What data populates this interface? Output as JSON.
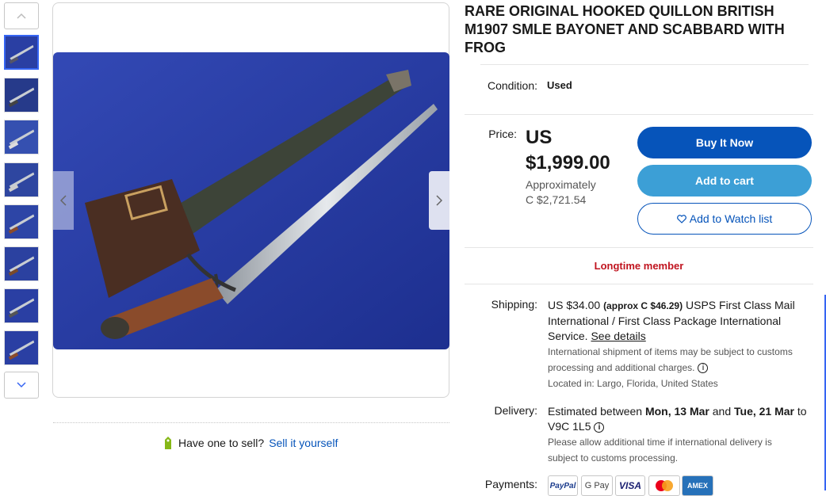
{
  "listing": {
    "title": "RARE ORIGINAL HOOKED QUILLON BRITISH M1907 SMLE BAYONET AND SCABBARD WITH FROG",
    "condition_label": "Condition:",
    "condition_value": "Used",
    "price_label": "Price:",
    "price_currency": "US",
    "price_amount": "$1,999.00",
    "approx_label": "Approximately",
    "approx_value": "C $2,721.54"
  },
  "actions": {
    "buy_now": "Buy It Now",
    "add_to_cart": "Add to cart",
    "watch": "Add to Watch list"
  },
  "seller": {
    "badge": "Longtime member"
  },
  "shipping": {
    "label": "Shipping:",
    "cost": "US $34.00",
    "approx": "(approx C $46.29)",
    "service": "USPS First Class Mail International / First Class Package International Service.",
    "details_link": "See details",
    "note": "International shipment of items may be subject to customs processing and additional charges.",
    "location": "Located in: Largo, Florida, United States"
  },
  "delivery": {
    "label": "Delivery:",
    "prefix": "Estimated between",
    "start": "Mon, 13 Mar",
    "and": "and",
    "end": "Tue, 21 Mar",
    "to": "to V9C 1L5",
    "note": "Please allow additional time if international delivery is subject to customs processing."
  },
  "payments": {
    "label": "Payments:",
    "methods": [
      "PayPal",
      "G Pay",
      "VISA",
      "Mastercard",
      "AMEX"
    ]
  },
  "sell_prompt": {
    "question": "Have one to sell?",
    "link": "Sell it yourself"
  },
  "colors": {
    "link": "#0654ba",
    "buy": "#0654ba",
    "cart": "#3c9fd6",
    "badge": "#c0141f",
    "photo_bg": "#2a3fa3"
  },
  "icons": {
    "thumb_up": "chevron-up-icon",
    "thumb_down": "chevron-down-icon",
    "prev": "chevron-left-icon",
    "next": "chevron-right-icon",
    "heart": "heart-icon",
    "tag": "price-tag-icon",
    "info": "info-icon"
  }
}
